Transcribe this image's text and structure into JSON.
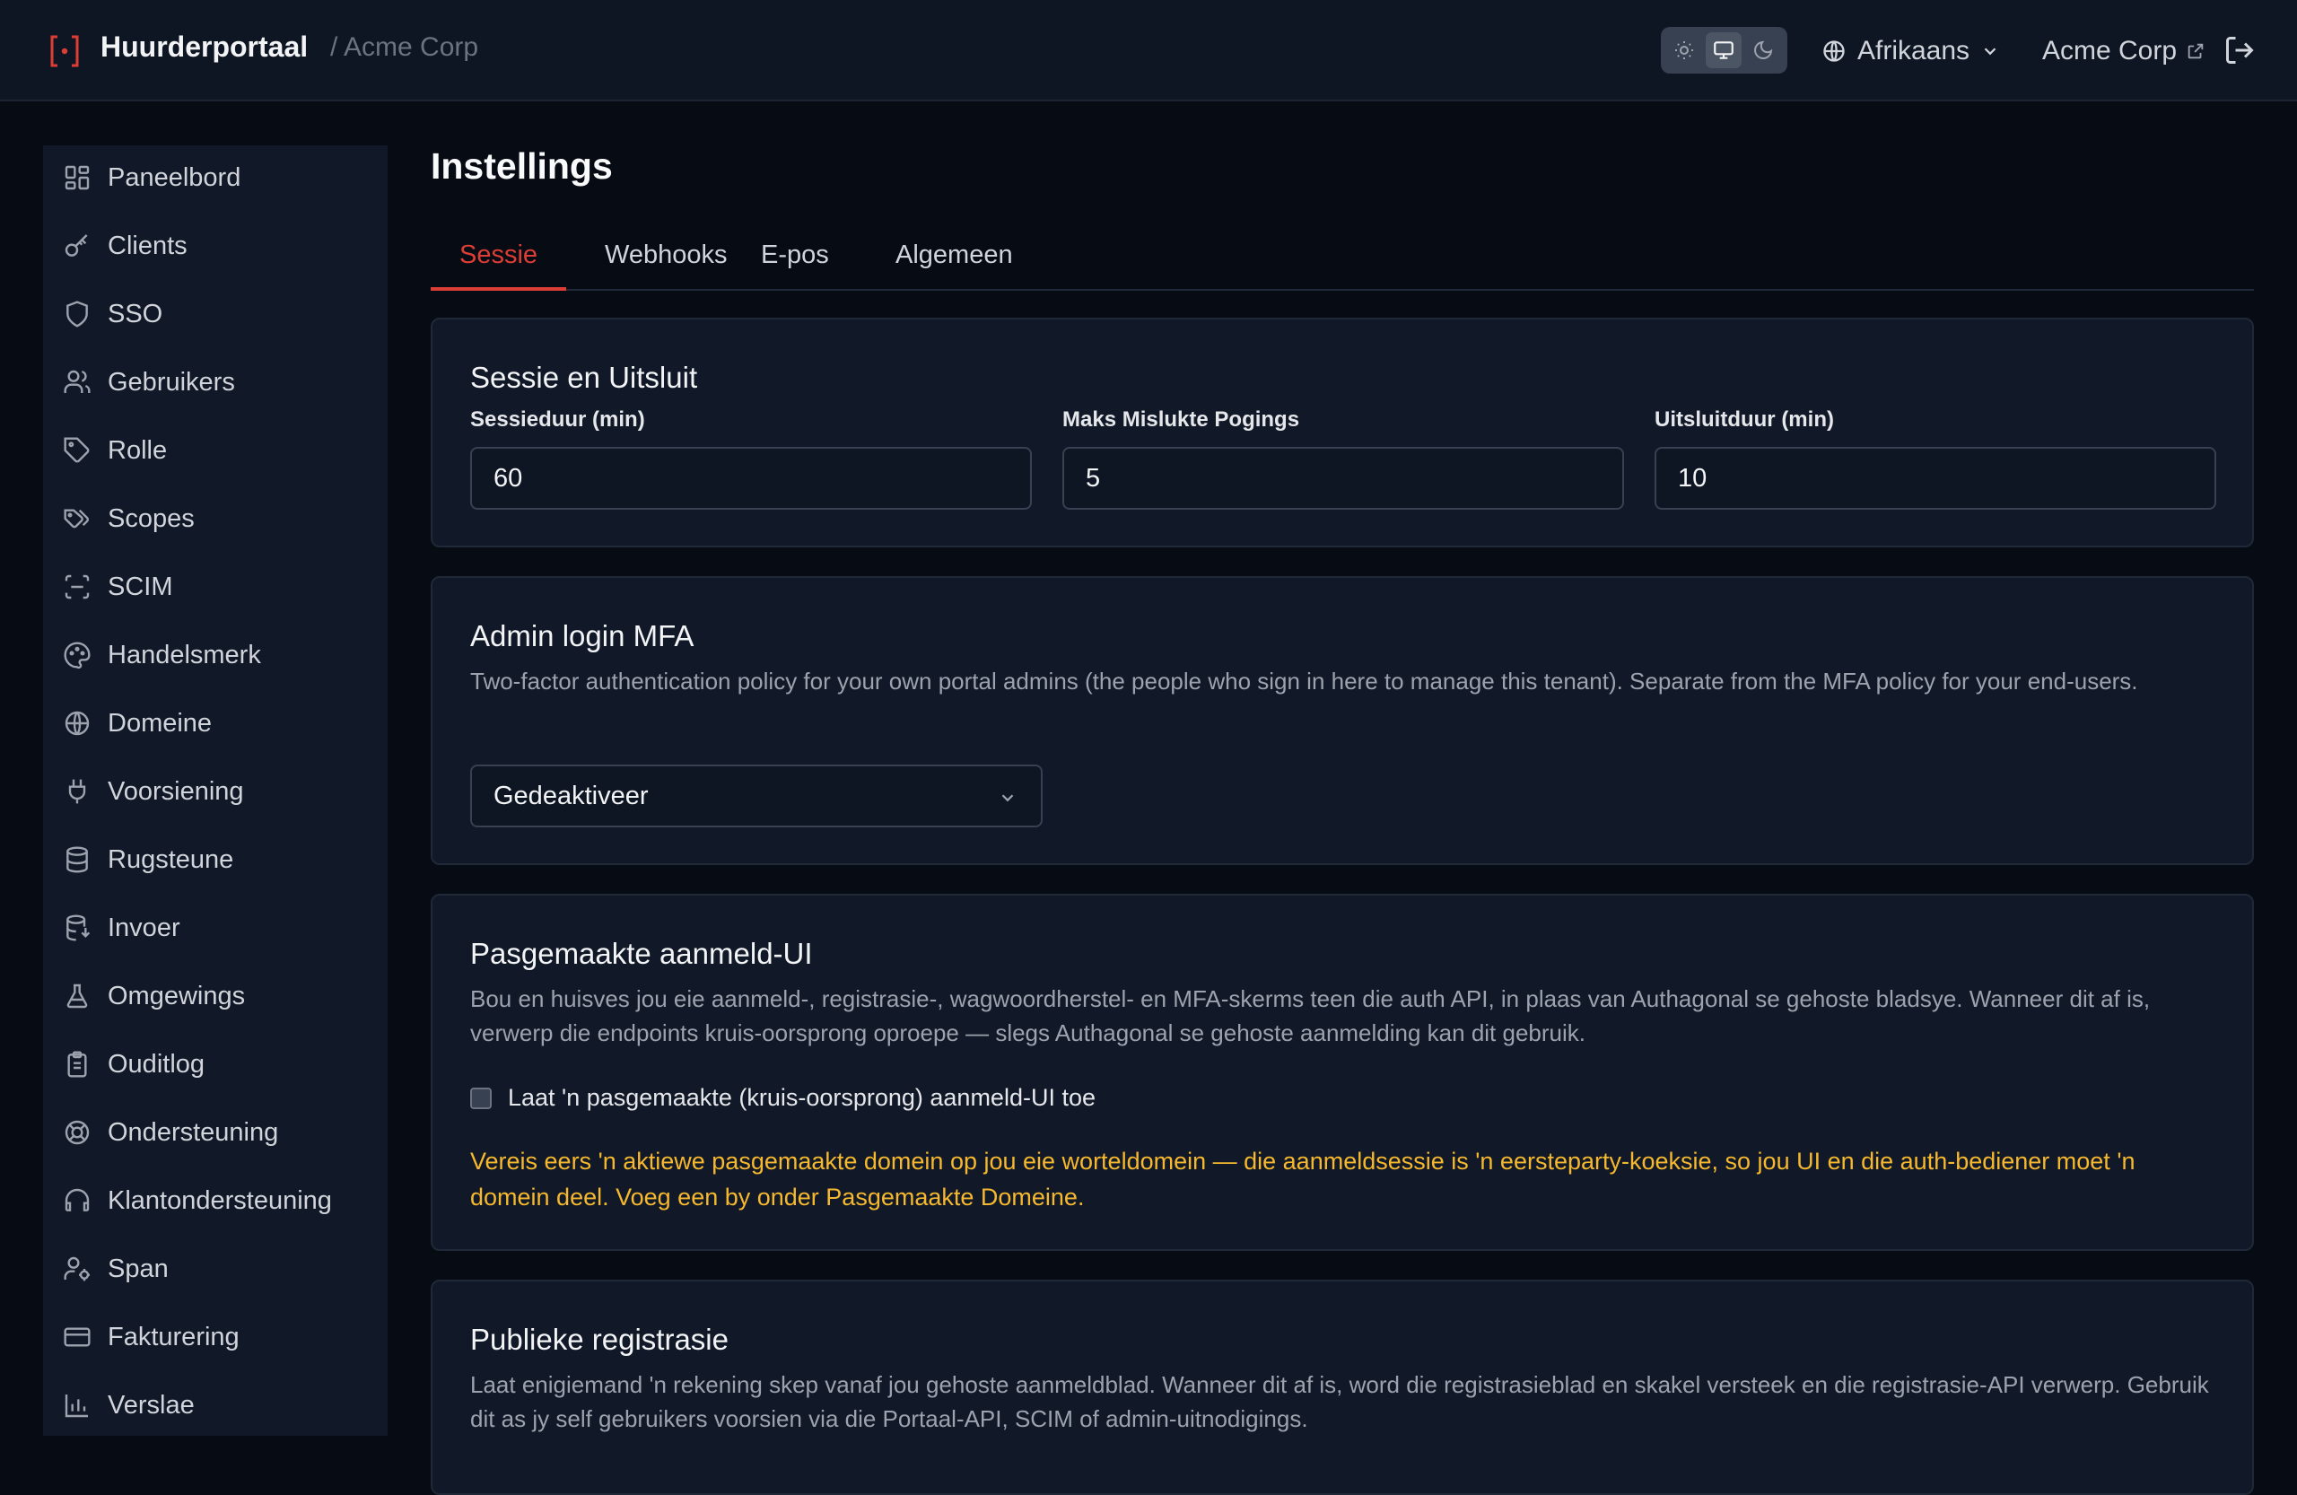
{
  "header": {
    "brand_title": "Huurderportaal",
    "brand_sub": "/ Acme Corp",
    "language": "Afrikaans",
    "tenant_link": "Acme Corp",
    "brand_color": "#dc3d35"
  },
  "sidebar": {
    "items": [
      {
        "label": "Paneelbord",
        "icon": "dashboard-icon"
      },
      {
        "label": "Clients",
        "icon": "key-icon"
      },
      {
        "label": "SSO",
        "icon": "shield-icon"
      },
      {
        "label": "Gebruikers",
        "icon": "users-icon"
      },
      {
        "label": "Rolle",
        "icon": "tag-icon"
      },
      {
        "label": "Scopes",
        "icon": "tags-icon"
      },
      {
        "label": "SCIM",
        "icon": "scan-icon"
      },
      {
        "label": "Handelsmerk",
        "icon": "palette-icon"
      },
      {
        "label": "Domeine",
        "icon": "globe-icon"
      },
      {
        "label": "Voorsiening",
        "icon": "plug-icon"
      },
      {
        "label": "Rugsteune",
        "icon": "database-icon"
      },
      {
        "label": "Invoer",
        "icon": "database-import-icon"
      },
      {
        "label": "Omgewings",
        "icon": "flask-icon"
      },
      {
        "label": "Ouditlog",
        "icon": "clipboard-icon"
      },
      {
        "label": "Ondersteuning",
        "icon": "lifebuoy-icon"
      },
      {
        "label": "Klantondersteuning",
        "icon": "headset-icon"
      },
      {
        "label": "Span",
        "icon": "user-cog-icon"
      },
      {
        "label": "Fakturering",
        "icon": "credit-card-icon"
      },
      {
        "label": "Verslae",
        "icon": "bar-chart-icon"
      }
    ]
  },
  "main": {
    "title": "Instellings",
    "tabs": [
      "Sessie",
      "Webhooks",
      "E-pos",
      "Algemeen"
    ],
    "active_tab": "Sessie",
    "session": {
      "title": "Sessie en Uitsluit",
      "fields": [
        {
          "label": "Sessieduur (min)",
          "value": "60"
        },
        {
          "label": "Maks Mislukte Pogings",
          "value": "5"
        },
        {
          "label": "Uitsluitduur (min)",
          "value": "10"
        }
      ]
    },
    "mfa": {
      "title": "Admin login MFA",
      "desc": "Two-factor authentication policy for your own portal admins (the people who sign in here to manage this tenant). Separate from the MFA policy for your end-users.",
      "selected": "Gedeaktiveer"
    },
    "custom_ui": {
      "title": "Pasgemaakte aanmeld-UI",
      "desc": "Bou en huisves jou eie aanmeld-, registrasie-, wagwoordherstel- en MFA-skerms teen die auth API, in plaas van Authagonal se gehoste bladsye. Wanneer dit af is, verwerp die endpoints kruis-oorsprong oproepe — slegs Authagonal se gehoste aanmelding kan dit gebruik.",
      "checkbox_label": "Laat 'n pasgemaakte (kruis-oorsprong) aanmeld-UI toe",
      "checked": false,
      "warning": "Vereis eers 'n aktiewe pasgemaakte domein op jou eie worteldomein — die aanmeldsessie is 'n eersteparty-koeksie, so jou UI en die auth-bediener moet 'n domein deel. Voeg een by onder Pasgemaakte Domeine.",
      "warning_color": "#f5b82e"
    },
    "registration": {
      "title": "Publieke registrasie",
      "desc": "Laat enigiemand 'n rekening skep vanaf jou gehoste aanmeldblad. Wanneer dit af is, word die registrasieblad en skakel versteek en die registrasie-API verwerp. Gebruik dit as jy self gebruikers voorsien via die Portaal-API, SCIM of admin-uitnodigings."
    }
  }
}
